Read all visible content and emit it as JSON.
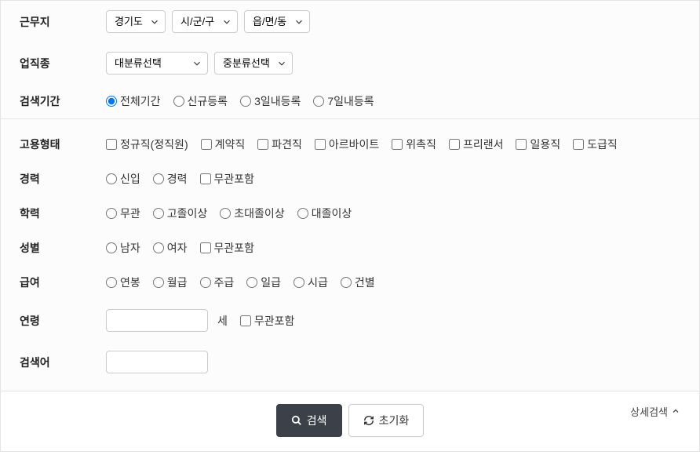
{
  "location": {
    "label": "근무지",
    "province": "경기도",
    "city": "시/군/구",
    "district": "읍/면/동"
  },
  "jobCategory": {
    "label": "업직종",
    "major": "대분류선택",
    "mid": "중분류선택"
  },
  "period": {
    "label": "검색기간",
    "options": [
      "전체기간",
      "신규등록",
      "3일내등록",
      "7일내등록"
    ],
    "selected": "전체기간"
  },
  "employmentType": {
    "label": "고용형태",
    "options": [
      "정규직(정직원)",
      "계약직",
      "파견직",
      "아르바이트",
      "위촉직",
      "프리랜서",
      "일용직",
      "도급직"
    ]
  },
  "career": {
    "label": "경력",
    "options": [
      "신입",
      "경력"
    ],
    "anyLabel": "무관포함"
  },
  "education": {
    "label": "학력",
    "options": [
      "무관",
      "고졸이상",
      "초대졸이상",
      "대졸이상"
    ]
  },
  "gender": {
    "label": "성별",
    "options": [
      "남자",
      "여자"
    ],
    "anyLabel": "무관포함"
  },
  "salary": {
    "label": "급여",
    "options": [
      "연봉",
      "월급",
      "주급",
      "일급",
      "시급",
      "건별"
    ]
  },
  "age": {
    "label": "연령",
    "unit": "세",
    "anyLabel": "무관포함",
    "value": ""
  },
  "keyword": {
    "label": "검색어",
    "value": ""
  },
  "buttons": {
    "search": "검색",
    "reset": "초기화",
    "detailToggle": "상세검색"
  }
}
